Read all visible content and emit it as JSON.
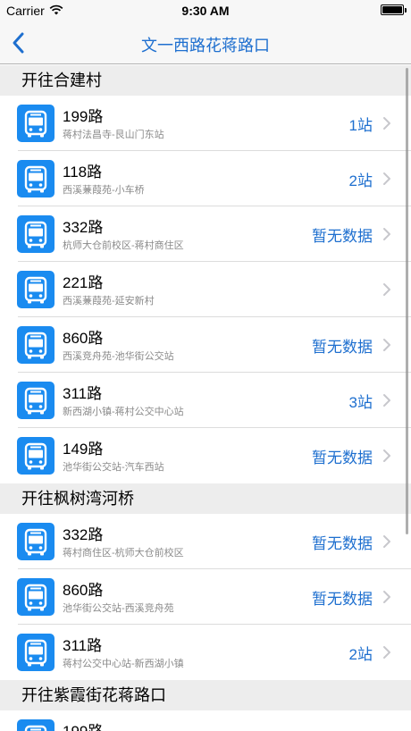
{
  "status_bar": {
    "carrier": "Carrier",
    "time": "9:30 AM"
  },
  "nav": {
    "title": "文一西路花蒋路口"
  },
  "sections": [
    {
      "header": "开往合建村",
      "rows": [
        {
          "route": "199路",
          "desc": "蒋村法昌寺-艮山门东站",
          "status": "1站"
        },
        {
          "route": "118路",
          "desc": "西溪蒹葭苑-小车桥",
          "status": "2站"
        },
        {
          "route": "332路",
          "desc": "杭师大仓前校区-蒋村商住区",
          "status": "暂无数据"
        },
        {
          "route": "221路",
          "desc": "西溪蒹葭苑-延安新村",
          "status": ""
        },
        {
          "route": "860路",
          "desc": "西溪竞舟苑-池华街公交站",
          "status": "暂无数据"
        },
        {
          "route": "311路",
          "desc": "新西湖小镇-蒋村公交中心站",
          "status": "3站"
        },
        {
          "route": "149路",
          "desc": "池华街公交站-汽车西站",
          "status": "暂无数据"
        }
      ]
    },
    {
      "header": "开往枫树湾河桥",
      "rows": [
        {
          "route": "332路",
          "desc": "蒋村商住区-杭师大仓前校区",
          "status": "暂无数据"
        },
        {
          "route": "860路",
          "desc": "池华街公交站-西溪竞舟苑",
          "status": "暂无数据"
        },
        {
          "route": "311路",
          "desc": "蒋村公交中心站-新西湖小镇",
          "status": "2站"
        }
      ]
    },
    {
      "header": "开往紫霞街花蒋路口",
      "rows": [
        {
          "route": "199路",
          "desc": "",
          "status": ""
        }
      ]
    }
  ],
  "colors": {
    "accent": "#1e6fcf",
    "icon_bg": "#1a8bf0"
  },
  "icons": {
    "route_icon": "bus-icon",
    "row_disclosure": "chevron-right-icon",
    "back": "chevron-left-icon"
  }
}
